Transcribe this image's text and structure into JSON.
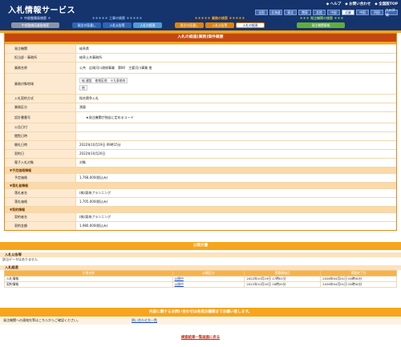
{
  "header": {
    "title": "入札情報サービス",
    "links": [
      "ヘルプ",
      "お問い合わせ",
      "全国版TOP"
    ],
    "regions": [
      "全国",
      "北海道",
      "東北",
      "関東",
      "北陸",
      "中部",
      "近畿",
      "中国",
      "四国",
      "九州沖縄"
    ],
    "active_region_index": 6
  },
  "nav": {
    "groups": [
      {
        "title": "中部整備局検索",
        "buttons": [
          "中部整備局業務検索"
        ]
      },
      {
        "title": "工事の検索",
        "buttons": [
          "発注の見通し",
          "入札公告等",
          "入札の経過"
        ]
      },
      {
        "title": "業務の検索",
        "buttons": [
          "発注の見通し",
          "入札公告等",
          "入札の経過"
        ]
      },
      {
        "title": "発注機関の検索",
        "buttons": [
          "発注機関情報"
        ]
      }
    ],
    "selected_group": 2,
    "selected_button": 2
  },
  "detail": {
    "title": "入札の経過(業務)案件概要",
    "rows": [
      {
        "label": "発注機関",
        "value": [
          "岐阜県"
        ]
      },
      {
        "label": "担当部・事務所",
        "value": [
          "岐阜土木事務所"
        ]
      },
      {
        "label": "業務名称",
        "value": [
          "公共　広域河川改修事業　第80　主要河川事業 他"
        ]
      },
      {
        "label": "業務対象地域",
        "value": [
          "岐 建設　他地区他　十九条地内",
          "他"
        ]
      },
      {
        "label": "入札契約方式",
        "value": [
          "指名競争入札"
        ]
      },
      {
        "label": "業務区分",
        "value": [
          "測量"
        ]
      },
      {
        "label": "設計書番号",
        "value": [
          "　　★発注機関が独自に定めるコード"
        ]
      },
      {
        "label": "公告日付",
        "value": [
          ""
        ]
      },
      {
        "label": "閲覧日時",
        "value": [
          ""
        ]
      },
      {
        "label": "開札日時",
        "value": [
          "2022年10月19日 09時15分"
        ]
      },
      {
        "label": "契約日",
        "value": [
          "2022年10月20日"
        ]
      },
      {
        "label": "電子入札対象",
        "value": [
          "対象"
        ]
      }
    ],
    "section_plan": "▼予定価格情報",
    "plan_rows": [
      {
        "label": "予定価格",
        "value": [
          "1,768,000(税込み)"
        ]
      }
    ],
    "section_winner": "▼落札者情報",
    "winner_rows": [
      {
        "label": "落札者名",
        "value": [
          "(株)東海プランニング"
        ]
      },
      {
        "label": "落札価格",
        "value": [
          "1,705,000(税込み)"
        ]
      }
    ],
    "section_contract": "▼契約情報",
    "contract_rows": [
      {
        "label": "契約者名",
        "value": [
          "(株)東海プランニング"
        ]
      },
      {
        "label": "契約金額",
        "value": [
          "1,980,000(税込み)"
        ]
      }
    ]
  },
  "docs": {
    "bar_title": "公開文書",
    "notice_title": "入札公告等",
    "notice_empty": "該当データはありません",
    "process_title": "入札経過",
    "columns": [
      "文書名称",
      "公開区分",
      "掲載開始日",
      "掲載終了日"
    ],
    "rows": [
      {
        "name": "入札情報",
        "link": "公開中",
        "start": "2022年10月19日 17時01分",
        "end": "2026年04月01日 00時00分"
      },
      {
        "name": "契約情報",
        "link": "公開中",
        "start": "2022年10月20日 16時20分",
        "end": "2026年04月01日 00時00分"
      }
    ]
  },
  "inquiry": {
    "bar_title": "内容に関するお問い合わせは各発注機関までお願い致します。",
    "text": "発注機関への連絡先等はこちらからご確認ください。",
    "link": "問い合わせ先一覧"
  },
  "footer": {
    "back_link": "検索結果一覧画面に戻る"
  }
}
